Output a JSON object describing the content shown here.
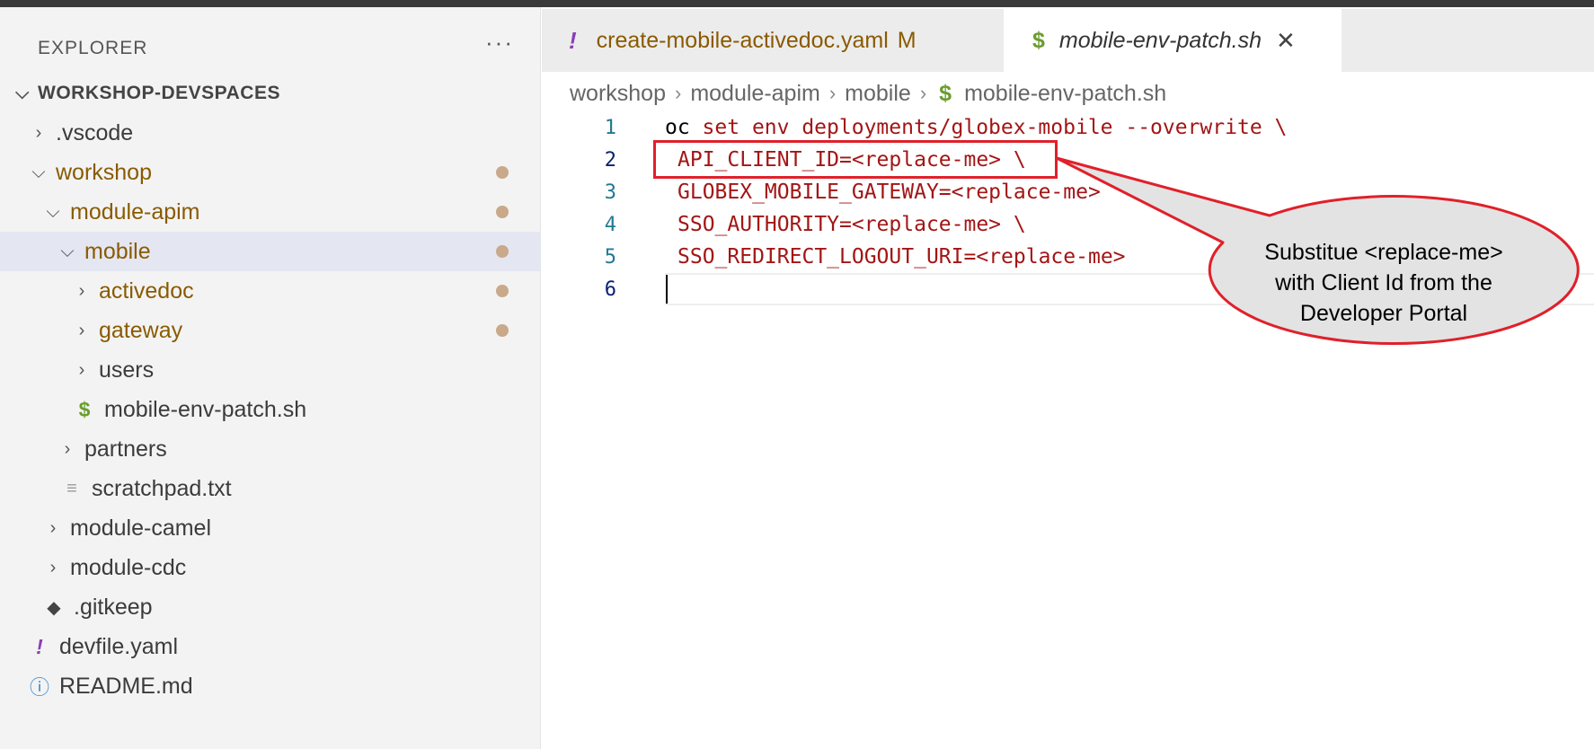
{
  "sidebar": {
    "header": "EXPLORER",
    "more_icon": "more-icon",
    "root": "WORKSHOP-DEVSPACES",
    "items": {
      "vscode": ".vscode",
      "workshop": "workshop",
      "module_apim": "module-apim",
      "mobile": "mobile",
      "activedoc": "activedoc",
      "gateway": "gateway",
      "users": "users",
      "mobile_env_patch": "mobile-env-patch.sh",
      "partners": "partners",
      "scratchpad": "scratchpad.txt",
      "module_camel": "module-camel",
      "module_cdc": "module-cdc",
      "gitkeep": ".gitkeep",
      "devfile": "devfile.yaml",
      "readme": "README.md"
    }
  },
  "tabs": {
    "tab1": {
      "label": "create-mobile-activedoc.yaml",
      "badge": "M"
    },
    "tab2": {
      "label": "mobile-env-patch.sh"
    }
  },
  "breadcrumb": {
    "items": [
      "workshop",
      "module-apim",
      "mobile",
      "mobile-env-patch.sh"
    ]
  },
  "code": {
    "line_numbers": [
      "1",
      "2",
      "3",
      "4",
      "5",
      "6"
    ],
    "line1_cmd": "oc",
    "line1_rest": " set env deployments/globex-mobile --overwrite \\",
    "line2_a": "API_CLIENT_ID",
    "line2_b": "=<replace-me> \\",
    "line3_a": "GLOBEX_MOBILE_GATEWAY",
    "line3_b": "=<replace-me>",
    "line4_a": "SSO_AUTHORITY",
    "line4_b": "=<replace-me> \\",
    "line5_a": "SSO_REDIRECT_LOGOUT_URI",
    "line5_b": "=<replace-me>"
  },
  "callout": {
    "line1": "Substitue <replace-me>",
    "line2": "with Client Id from the",
    "line3": "Developer Portal"
  },
  "colors": {
    "accent_red": "#e0202a",
    "modified_dot": "#c9a98a",
    "sh_icon": "#6a9d2c",
    "yaml_icon": "#8a3fb7"
  }
}
